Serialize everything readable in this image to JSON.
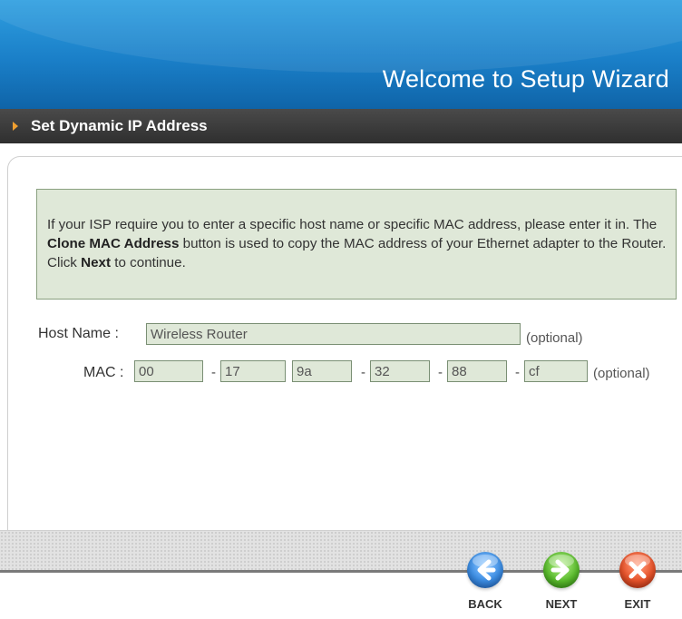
{
  "header": {
    "title": "Welcome to Setup Wizard"
  },
  "section": {
    "title": "Set Dynamic IP Address"
  },
  "info": {
    "part1": "If your ISP require you to enter a specific host name or specific MAC address, please enter it in. The ",
    "bold1": "Clone MAC Address",
    "part2": " button is used to copy the MAC address of your Ethernet adapter to the Router. Click ",
    "bold2": "Next",
    "part3": " to continue."
  },
  "form": {
    "host_label": "Host Name :",
    "host_value": "Wireless Router",
    "host_optional": "(optional)",
    "mac_label": "MAC :",
    "mac": [
      "00",
      "17",
      "9a",
      "32",
      "88",
      "cf"
    ],
    "separator": "-",
    "mac_optional": "(optional)"
  },
  "nav": {
    "back": "BACK",
    "next": "NEXT",
    "exit": "EXIT"
  },
  "icons": {
    "back": "arrow-left-icon",
    "next": "arrow-right-icon",
    "exit": "close-icon"
  },
  "colors": {
    "header": "#1a7fc8",
    "section_bar": "#333333",
    "field_bg": "#dfe8d8",
    "info_bg": "#dfe8d8"
  }
}
